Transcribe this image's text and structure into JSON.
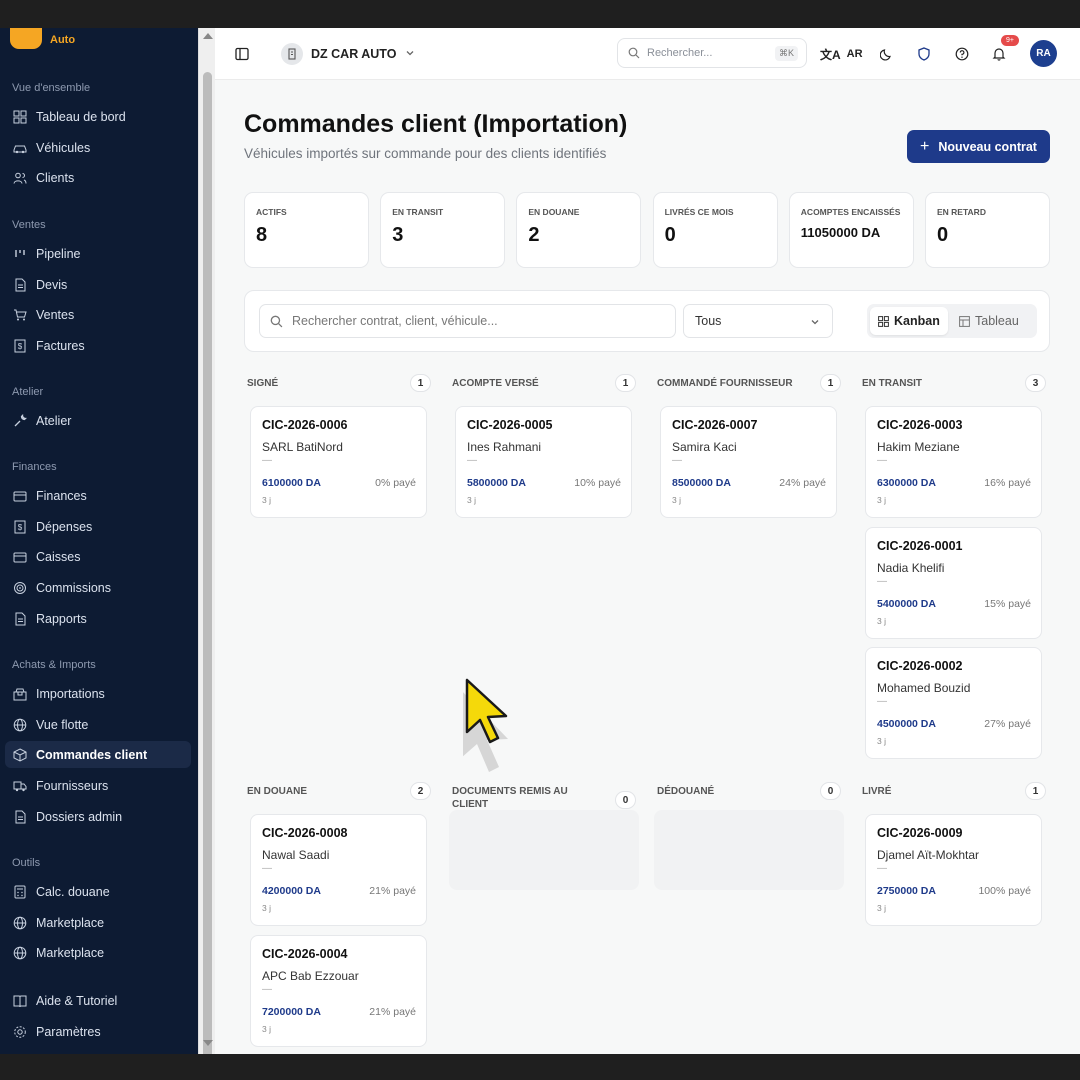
{
  "sidebar": {
    "logo_text": "Auto",
    "sections": [
      {
        "title": "Vue d'ensemble",
        "items": [
          "Tableau de bord",
          "Véhicules",
          "Clients"
        ]
      },
      {
        "title": "Ventes",
        "items": [
          "Pipeline",
          "Devis",
          "Ventes",
          "Factures"
        ]
      },
      {
        "title": "Atelier",
        "items": [
          "Atelier"
        ]
      },
      {
        "title": "Finances",
        "items": [
          "Finances",
          "Dépenses",
          "Caisses",
          "Commissions",
          "Rapports"
        ]
      },
      {
        "title": "Achats & Imports",
        "items": [
          "Importations",
          "Vue flotte",
          "Commandes client",
          "Fournisseurs",
          "Dossiers admin"
        ]
      },
      {
        "title": "Outils",
        "items": [
          "Calc. douane",
          "Marketplace",
          "Marketplace"
        ]
      }
    ],
    "footer": [
      "Aide & Tutoriel",
      "Paramètres"
    ],
    "active": "Commandes client"
  },
  "topbar": {
    "company": "DZ CAR AUTO",
    "search_placeholder": "Rechercher...",
    "search_shortcut": "⌘K",
    "language": "AR",
    "notif_count": "9+",
    "avatar": "RA"
  },
  "page": {
    "title": "Commandes client (Importation)",
    "subtitle": "Véhicules importés sur commande pour des clients identifiés",
    "new_button": "Nouveau contrat"
  },
  "stats": [
    {
      "label": "ACTIFS",
      "value": "8"
    },
    {
      "label": "EN TRANSIT",
      "value": "3"
    },
    {
      "label": "EN DOUANE",
      "value": "2"
    },
    {
      "label": "LIVRÉS CE MOIS",
      "value": "0"
    },
    {
      "label": "ACOMPTES ENCAISSÉS",
      "value": "11050000 DA"
    },
    {
      "label": "EN RETARD",
      "value": "0"
    }
  ],
  "filters": {
    "search_placeholder": "Rechercher contrat, client, véhicule...",
    "select_value": "Tous",
    "view_kanban": "Kanban",
    "view_table": "Tableau"
  },
  "columns": [
    {
      "title": "SIGNÉ",
      "count": "1",
      "cards": [
        {
          "id": "CIC-2026-0006",
          "client": "SARL BatiNord",
          "vehicle": "—",
          "amount": "6100000 DA",
          "paid": "0% payé",
          "days": "3 j"
        }
      ]
    },
    {
      "title": "ACOMPTE VERSÉ",
      "count": "1",
      "cards": [
        {
          "id": "CIC-2026-0005",
          "client": "Ines Rahmani",
          "vehicle": "—",
          "amount": "5800000 DA",
          "paid": "10% payé",
          "days": "3 j"
        }
      ]
    },
    {
      "title": "COMMANDÉ FOURNISSEUR",
      "count": "1",
      "cards": [
        {
          "id": "CIC-2026-0007",
          "client": "Samira Kaci",
          "vehicle": "—",
          "amount": "8500000 DA",
          "paid": "24% payé",
          "days": "3 j"
        }
      ]
    },
    {
      "title": "EN TRANSIT",
      "count": "3",
      "cards": [
        {
          "id": "CIC-2026-0003",
          "client": "Hakim Meziane",
          "vehicle": "—",
          "amount": "6300000 DA",
          "paid": "16% payé",
          "days": "3 j"
        },
        {
          "id": "CIC-2026-0001",
          "client": "Nadia Khelifi",
          "vehicle": "—",
          "amount": "5400000 DA",
          "paid": "15% payé",
          "days": "3 j"
        },
        {
          "id": "CIC-2026-0002",
          "client": "Mohamed Bouzid",
          "vehicle": "—",
          "amount": "4500000 DA",
          "paid": "27% payé",
          "days": "3 j"
        }
      ]
    },
    {
      "title": "EN DOUANE",
      "count": "2",
      "cards": [
        {
          "id": "CIC-2026-0008",
          "client": "Nawal Saadi",
          "vehicle": "—",
          "amount": "4200000 DA",
          "paid": "21% payé",
          "days": "3 j"
        },
        {
          "id": "CIC-2026-0004",
          "client": "APC Bab Ezzouar",
          "vehicle": "—",
          "amount": "7200000 DA",
          "paid": "21% payé",
          "days": "3 j"
        }
      ]
    },
    {
      "title": "DOCUMENTS REMIS AU CLIENT",
      "count": "0",
      "cards": []
    },
    {
      "title": "DÉDOUANÉ",
      "count": "0",
      "cards": []
    },
    {
      "title": "LIVRÉ",
      "count": "1",
      "cards": [
        {
          "id": "CIC-2026-0009",
          "client": "Djamel Aït-Mokhtar",
          "vehicle": "—",
          "amount": "2750000 DA",
          "paid": "100% payé",
          "days": "3 j"
        }
      ]
    }
  ],
  "colors": {
    "sidebar_bg": "#0d1b33",
    "accent": "#1e3a8a",
    "logo": "#f5a623",
    "cursor": "#f5d90a"
  }
}
